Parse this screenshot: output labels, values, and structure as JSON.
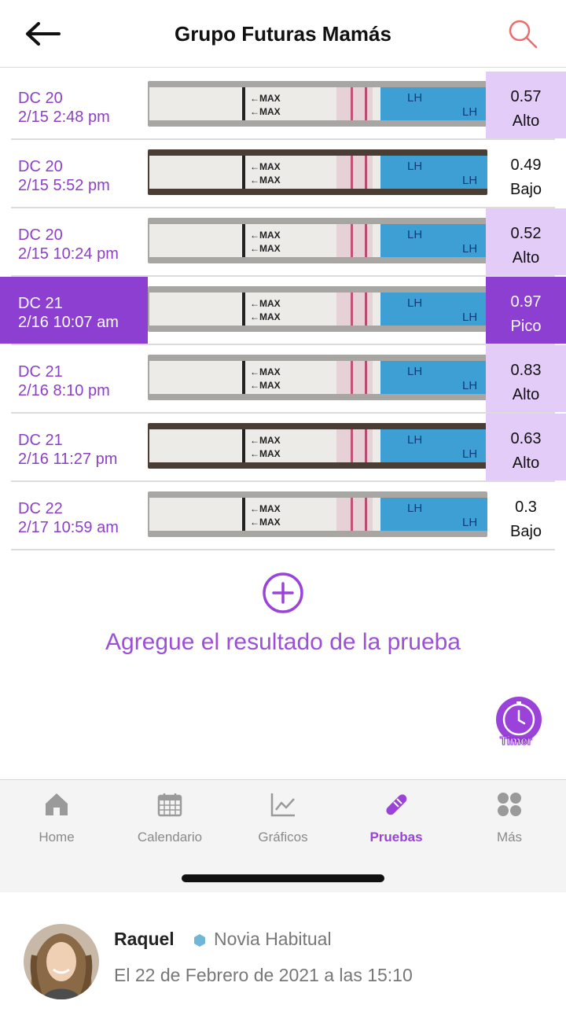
{
  "header": {
    "title": "Grupo Futuras Mamás",
    "back_icon": "arrow-left-icon",
    "search_icon": "search-icon"
  },
  "colors": {
    "brand": "#9a42d9",
    "peak_bg": "#8c3fd1",
    "high_bg": "#e4ccf8",
    "date_text": "#8d3fc8"
  },
  "tests": [
    {
      "cycle_day": "DC 20",
      "datetime": "2/15 2:48 pm",
      "value": "0.57",
      "level": "Alto"
    },
    {
      "cycle_day": "DC 20",
      "datetime": "2/15 5:52 pm",
      "value": "0.49",
      "level": "Bajo"
    },
    {
      "cycle_day": "DC 20",
      "datetime": "2/15 10:24 pm",
      "value": "0.52",
      "level": "Alto"
    },
    {
      "cycle_day": "DC 21",
      "datetime": "2/16 10:07 am",
      "value": "0.97",
      "level": "Pico"
    },
    {
      "cycle_day": "DC 21",
      "datetime": "2/16 8:10 pm",
      "value": "0.83",
      "level": "Alto"
    },
    {
      "cycle_day": "DC 21",
      "datetime": "2/16 11:27 pm",
      "value": "0.63",
      "level": "Alto"
    },
    {
      "cycle_day": "DC 22",
      "datetime": "2/17 10:59 am",
      "value": "0.3",
      "level": "Bajo"
    }
  ],
  "strip_text": {
    "max_arrow": "←MAX",
    "lh_brand": "LH"
  },
  "add_result": {
    "label": "Agregue el resultado de la prueba",
    "icon": "plus-circle-icon"
  },
  "timer": {
    "label": "Timer",
    "icon": "stopwatch-icon"
  },
  "bottom_nav": {
    "items": [
      {
        "label": "Home",
        "icon": "home-icon"
      },
      {
        "label": "Calendario",
        "icon": "calendar-icon"
      },
      {
        "label": "Gráficos",
        "icon": "chart-icon"
      },
      {
        "label": "Pruebas",
        "icon": "test-strip-icon",
        "active": true
      },
      {
        "label": "Más",
        "icon": "more-grid-icon"
      }
    ]
  },
  "comment": {
    "author": "Raquel",
    "badge": "Novia Habitual",
    "date": "El 22 de Febrero de 2021 a las 15:10"
  }
}
